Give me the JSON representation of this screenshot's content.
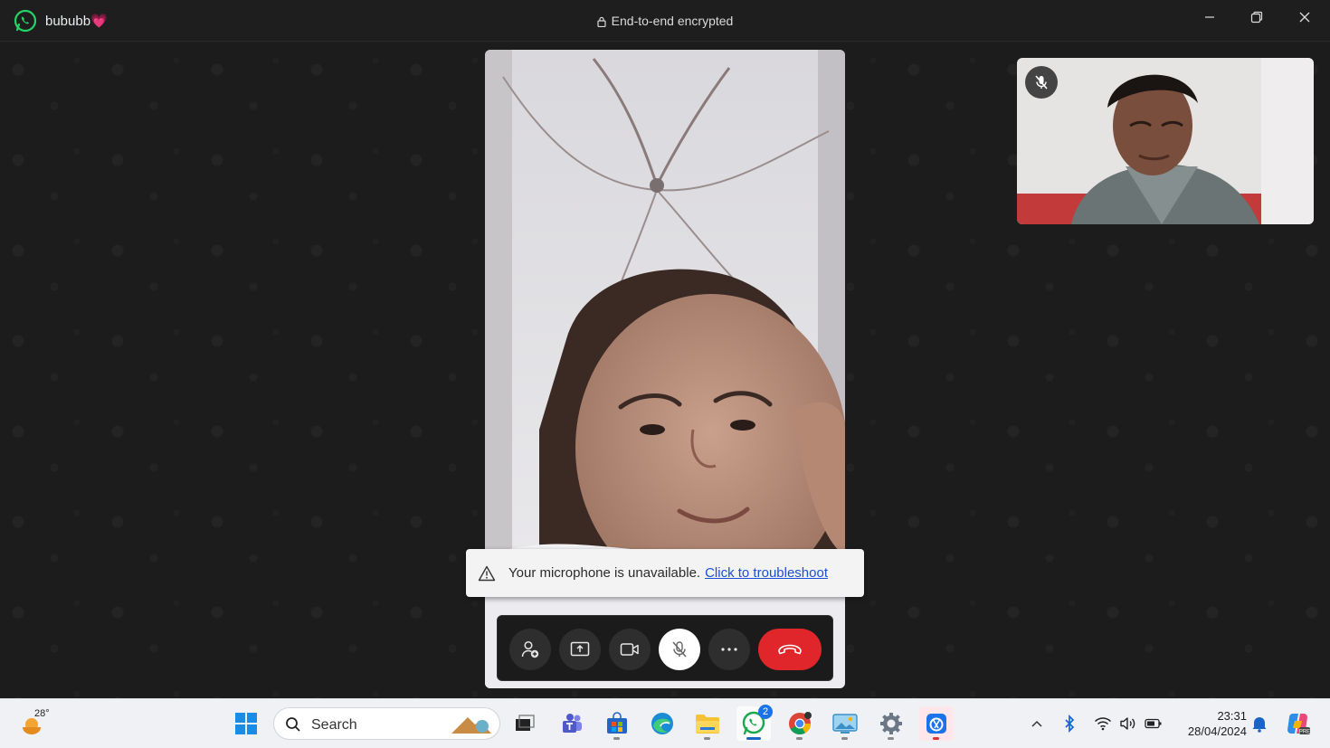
{
  "window": {
    "contact_name": "bububb💗",
    "encryption_label": "End-to-end encrypted"
  },
  "call": {
    "remote_participant": "remote-video-feed",
    "local_mic_state": "muted",
    "toast": {
      "message": "Your microphone is unavailable.",
      "link": "Click to troubleshoot"
    },
    "controls": [
      {
        "name": "add-participant",
        "icon": "person-add-icon"
      },
      {
        "name": "share-screen",
        "icon": "share-screen-icon"
      },
      {
        "name": "camera",
        "icon": "video-camera-icon"
      },
      {
        "name": "microphone",
        "icon": "mic-off-icon",
        "state": "muted"
      },
      {
        "name": "more-options",
        "icon": "ellipsis-icon"
      },
      {
        "name": "end-call",
        "icon": "phone-hangup-icon"
      }
    ]
  },
  "taskbar": {
    "weather_temp": "28°",
    "search_placeholder": "Search",
    "whatsapp_badge": "2",
    "clock_time": "23:31",
    "clock_date": "28/04/2024",
    "apps": [
      "start",
      "search",
      "task-view",
      "teams",
      "store",
      "edge",
      "file-explorer",
      "whatsapp",
      "chrome",
      "photos",
      "settings",
      "snipping-tool"
    ]
  },
  "colors": {
    "whatsapp_green": "#25d366",
    "end_call_red": "#e0262a",
    "link_blue": "#1d4fd6"
  }
}
